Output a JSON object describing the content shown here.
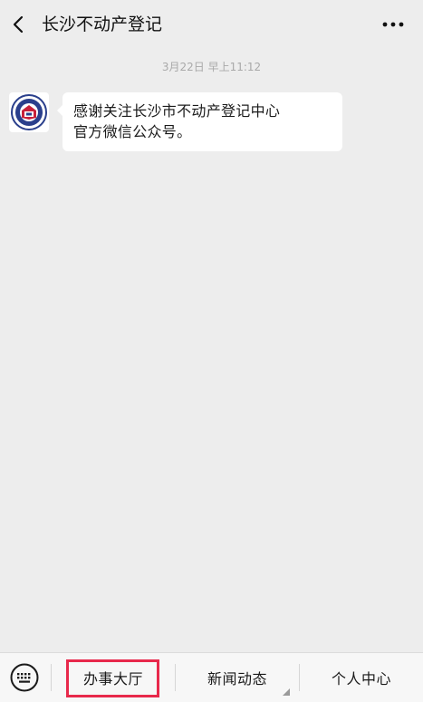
{
  "header": {
    "title": "长沙不动产登记",
    "back_icon": "chevron-left-icon",
    "more_icon": "ellipsis-icon"
  },
  "chat": {
    "timestamp": "3月22日 早上11:12",
    "message": {
      "lines": [
        "感谢关注长沙市不动产登记中心",
        "官方微信公众号。"
      ]
    },
    "avatar_icon": "seal-logo-icon"
  },
  "bottom_menu": {
    "keyboard_icon": "keyboard-icon",
    "items": [
      {
        "label": "办事大厅"
      },
      {
        "label": "新闻动态"
      },
      {
        "label": "个人中心"
      }
    ]
  },
  "colors": {
    "background": "#ededed",
    "bubble": "#ffffff",
    "highlight": "#e8294b",
    "timestamp": "#a9a9a9"
  }
}
